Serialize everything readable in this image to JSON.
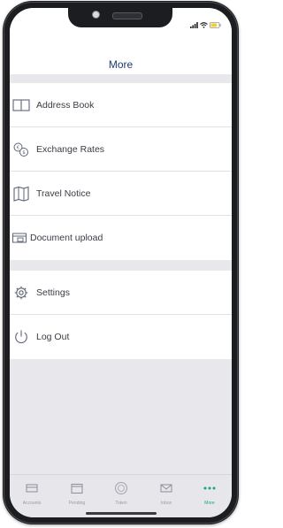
{
  "screen": {
    "title": "More"
  },
  "menu": {
    "groups": [
      {
        "items": [
          {
            "label": "Address Book",
            "icon": "book-icon"
          },
          {
            "label": "Exchange Rates",
            "icon": "exchange-rates-icon"
          },
          {
            "label": "Travel Notice",
            "icon": "map-icon"
          },
          {
            "label": "Document upload",
            "icon": "document-upload-icon"
          }
        ]
      },
      {
        "items": [
          {
            "label": "Settings",
            "icon": "gear-icon"
          },
          {
            "label": "Log Out",
            "icon": "power-icon"
          }
        ]
      }
    ]
  },
  "tabbar": {
    "tabs": [
      {
        "label": "Accounts",
        "icon": "card-icon",
        "active": false
      },
      {
        "label": "Pending",
        "icon": "calendar-icon",
        "active": false
      },
      {
        "label": "Token",
        "icon": "token-icon",
        "active": false
      },
      {
        "label": "Inbox",
        "icon": "mail-icon",
        "active": false
      },
      {
        "label": "More",
        "icon": "more-dots-icon",
        "active": true
      }
    ]
  },
  "colors": {
    "accent": "#18a389",
    "title": "#1f3a6e",
    "icon": "#5f6575",
    "background": "#e8e8ec"
  }
}
